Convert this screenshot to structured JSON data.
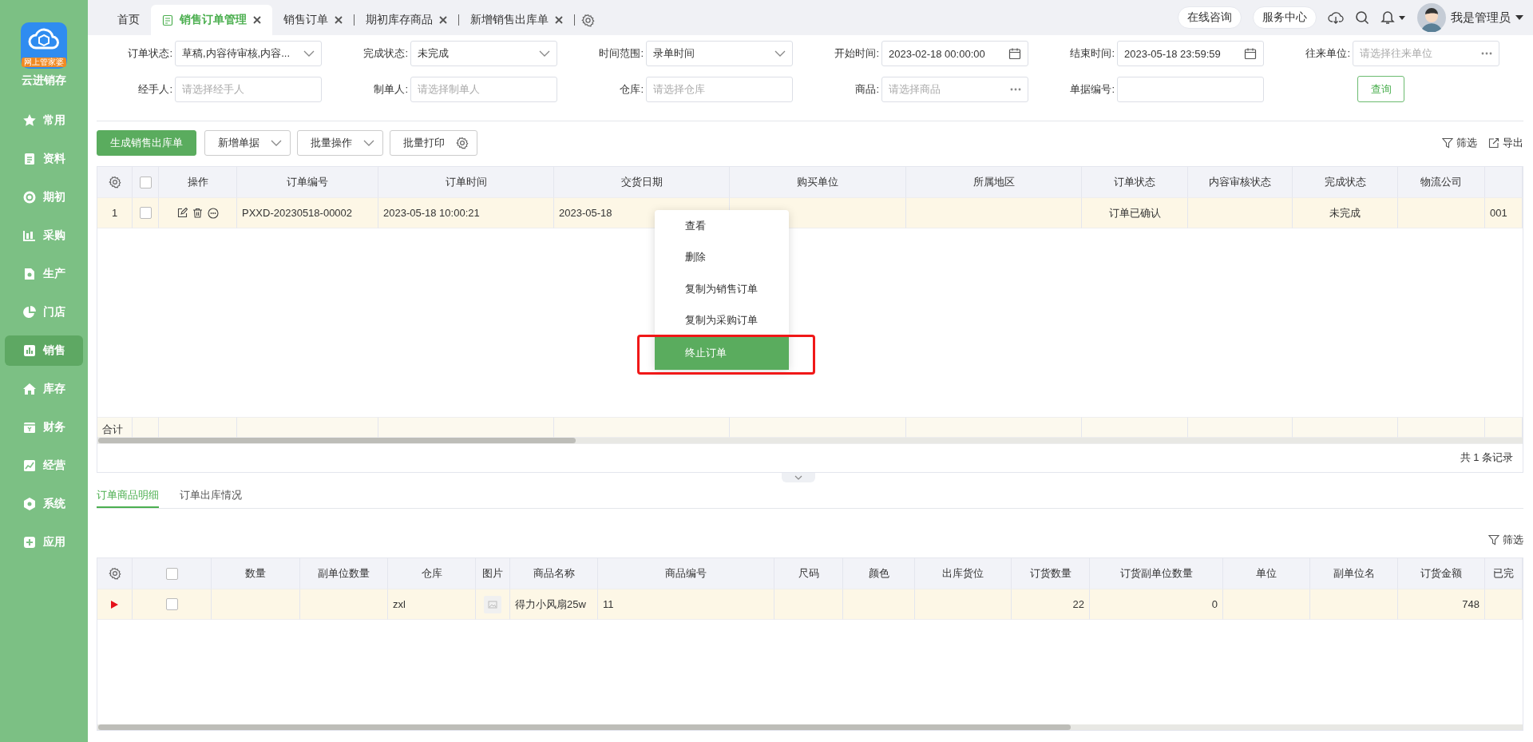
{
  "sidebar": {
    "logo_badge": "网上管家婆",
    "app_name": "云进销存",
    "items": [
      {
        "label": "常用",
        "selected": false
      },
      {
        "label": "资料",
        "selected": false
      },
      {
        "label": "期初",
        "selected": false
      },
      {
        "label": "采购",
        "selected": false
      },
      {
        "label": "生产",
        "selected": false
      },
      {
        "label": "门店",
        "selected": false
      },
      {
        "label": "销售",
        "selected": true
      },
      {
        "label": "库存",
        "selected": false
      },
      {
        "label": "财务",
        "selected": false
      },
      {
        "label": "经营",
        "selected": false
      },
      {
        "label": "系统",
        "selected": false
      },
      {
        "label": "应用",
        "selected": false
      }
    ]
  },
  "tabs": [
    {
      "label": "首页",
      "selected": false,
      "closable": false
    },
    {
      "label": "销售订单管理",
      "selected": true,
      "closable": true
    },
    {
      "label": "销售订单",
      "selected": false,
      "closable": true
    },
    {
      "label": "期初库存商品",
      "selected": false,
      "closable": true
    },
    {
      "label": "新增销售出库单",
      "selected": false,
      "closable": true
    }
  ],
  "header": {
    "buttons": [
      "在线咨询",
      "服务中心"
    ],
    "user": "我是管理员"
  },
  "filters": [
    {
      "label": "订单状态:",
      "kind": "select",
      "value": "草稿,内容待审核,内容..."
    },
    {
      "label": "完成状态:",
      "kind": "select",
      "value": "未完成"
    },
    {
      "label": "时间范围:",
      "kind": "select",
      "value": "录单时间"
    },
    {
      "label": "开始时间:",
      "kind": "date",
      "value": "2023-02-18 00:00:00"
    },
    {
      "label": "结束时间:",
      "kind": "date",
      "value": "2023-05-18 23:59:59"
    },
    {
      "label": "往来单位:",
      "kind": "picker",
      "placeholder": "请选择往来单位"
    },
    {
      "label": "经手人:",
      "kind": "text",
      "placeholder": "请选择经手人"
    },
    {
      "label": "制单人:",
      "kind": "text",
      "placeholder": "请选择制单人"
    },
    {
      "label": "仓库:",
      "kind": "text",
      "placeholder": "请选择仓库"
    },
    {
      "label": "商品:",
      "kind": "picker",
      "placeholder": "请选择商品"
    },
    {
      "label": "单据编号:",
      "kind": "text"
    }
  ],
  "query_button": "查询",
  "toolbar": {
    "buttons": [
      {
        "label": "生成销售出库单",
        "kind": "primary"
      },
      {
        "label": "新增单据",
        "kind": "dropdown"
      },
      {
        "label": "批量操作",
        "kind": "dropdown"
      },
      {
        "label": "批量打印",
        "kind": "settings"
      }
    ],
    "actions": [
      "筛选",
      "导出"
    ]
  },
  "orders_table": {
    "all_checked": false,
    "columns": [
      "操作",
      "订单编号",
      "订单时间",
      "交货日期",
      "购买单位",
      "所属地区",
      "订单状态",
      "内容审核状态",
      "完成状态",
      "物流公司"
    ],
    "rows": [
      {
        "index": "1",
        "checked": false,
        "order_no": "PXXD-20230518-00002",
        "order_time": "2023-05-18 10:00:21",
        "delivery_date": "2023-05-18",
        "order_status": "订单已确认",
        "completion_status": "未完成",
        "column_13": "001"
      }
    ],
    "total_label": "合计",
    "footer": "共 1 条记录"
  },
  "context_menu": {
    "items": [
      {
        "label": "查看",
        "highlighted": false
      },
      {
        "label": "删除",
        "highlighted": false
      },
      {
        "label": "复制为销售订单",
        "highlighted": false
      },
      {
        "label": "复制为采购订单",
        "highlighted": false
      },
      {
        "label": "终止订单",
        "highlighted": true
      }
    ]
  },
  "detail_tabs": [
    {
      "label": "订单商品明细",
      "selected": true
    },
    {
      "label": "订单出库情况",
      "selected": false
    }
  ],
  "detail_table": {
    "all_checked": false,
    "filter_label": "筛选",
    "columns": [
      "数量",
      "副单位数量",
      "仓库",
      "图片",
      "商品名称",
      "商品编号",
      "尺码",
      "颜色",
      "出库货位",
      "订货数量",
      "订货副单位数量",
      "单位",
      "副单位名",
      "订货金额",
      "已完"
    ],
    "rows": [
      {
        "current": true,
        "checked": false,
        "warehouse": "zxl",
        "product_name": "得力小风扇25w",
        "product_code": "11",
        "order_qty": "22",
        "order_sub_qty": "0",
        "order_amount": "748"
      }
    ]
  }
}
